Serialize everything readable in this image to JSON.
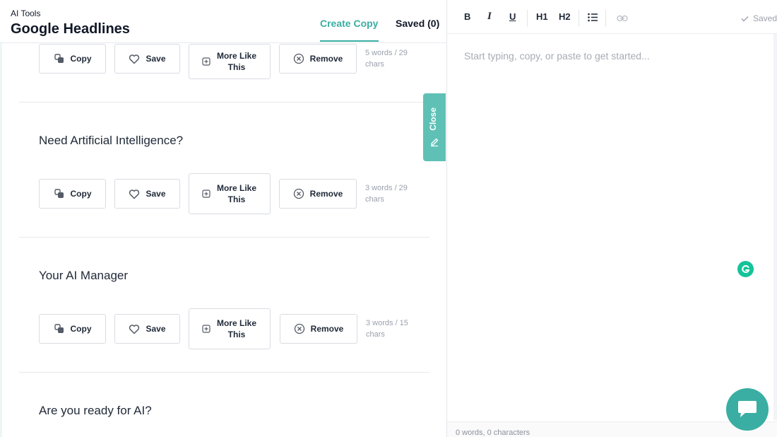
{
  "header": {
    "breadcrumb": "AI Tools",
    "title": "Google Headlines",
    "tabs": {
      "create": "Create Copy",
      "saved": "Saved (0)"
    }
  },
  "buttons": {
    "copy": "Copy",
    "save": "Save",
    "more_like_this": "More Like This",
    "remove": "Remove"
  },
  "results": [
    {
      "headline": "",
      "meta": "5 words / 29 chars"
    },
    {
      "headline": "Need Artificial Intelligence?",
      "meta": "3 words / 29 chars"
    },
    {
      "headline": "Your AI Manager",
      "meta": "3 words / 15 chars"
    },
    {
      "headline": "Are you ready for AI?",
      "meta": ""
    }
  ],
  "close_tab": {
    "label": "Close"
  },
  "editor": {
    "toolbar": {
      "bold": "B",
      "italic": "I",
      "underline": "U",
      "h1": "H1",
      "h2": "H2"
    },
    "saved_status": "Saved",
    "placeholder": "Start typing, copy, or paste to get started...",
    "footer": "0 words, 0 characters"
  },
  "colors": {
    "accent": "#3aaea2",
    "close_tab": "#5fc1b6",
    "grammarly": "#15c39a"
  }
}
